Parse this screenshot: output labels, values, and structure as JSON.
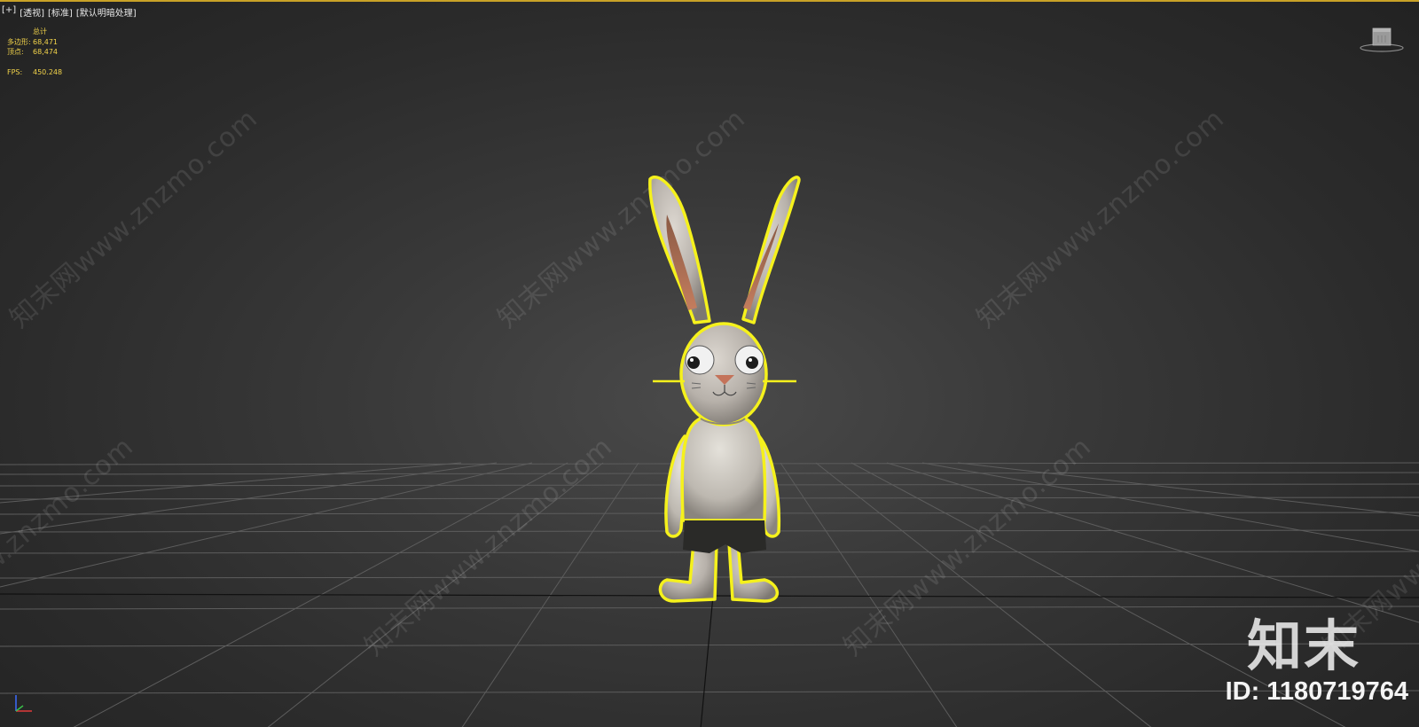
{
  "viewport": {
    "menu_plus": "[+]",
    "menu_view": "[透视]",
    "menu_shading": "[标准]",
    "menu_lighting": "[默认明暗处理]"
  },
  "stats": {
    "header": "总计",
    "polygons_label": "多边形:",
    "polygons_value": "68,471",
    "vertices_label": "顶点:",
    "vertices_value": "68,474",
    "fps_label": "FPS:",
    "fps_value": "450.248"
  },
  "watermark": {
    "text": "知末网www.znzmo.com"
  },
  "branding": {
    "logo_text": "知末",
    "id_text": "ID: 1180719764"
  },
  "colors": {
    "selection_outline": "#f5f11c",
    "stats_text": "#f2d34a",
    "viewport_border": "#c9a227"
  },
  "icons": {
    "viewcube": "viewcube-icon",
    "axis": "axis-gizmo-icon"
  }
}
